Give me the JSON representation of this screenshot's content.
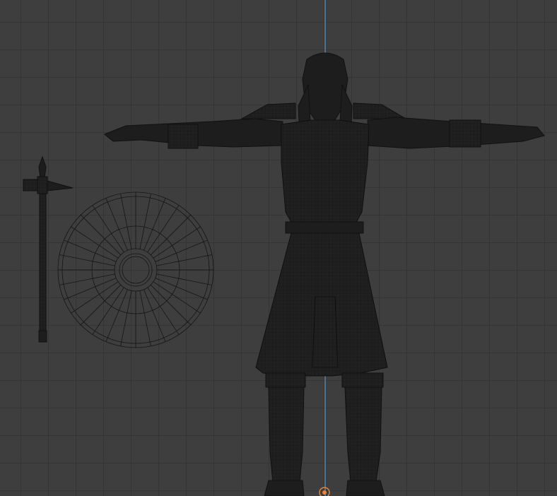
{
  "viewport": {
    "mode": "wireframe",
    "view": "front-orthographic",
    "background_color": "#3e3e3e",
    "grid_line_color": "#353535",
    "axis_line_color": "#5aa9e6",
    "origin_marker_color": "#e8873a"
  },
  "objects": [
    {
      "name": "warrior-character",
      "pose": "t-pose",
      "color": "#1d1d1d"
    },
    {
      "name": "war-hammer",
      "color": "#1d1d1d"
    },
    {
      "name": "round-shield",
      "color": "#1d1d1d"
    }
  ]
}
